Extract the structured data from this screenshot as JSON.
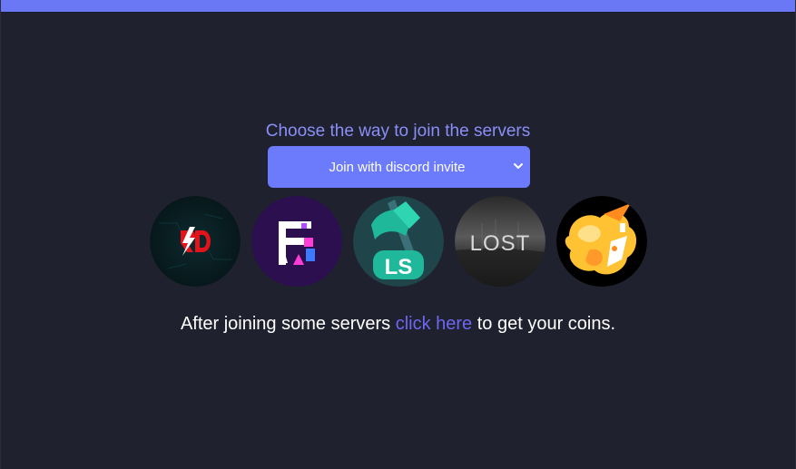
{
  "prompt": "Choose the way to join the servers",
  "join_method": {
    "selected": "Join with discord invite"
  },
  "servers": [
    {
      "icon": "rd-lightning-icon",
      "label": "RD"
    },
    {
      "icon": "purple-f-logo-icon"
    },
    {
      "icon": "ls-axe-logo-icon",
      "label": "LS"
    },
    {
      "icon": "lost-logo-icon",
      "label": "LOST"
    },
    {
      "icon": "orange-abstract-logo-icon"
    }
  ],
  "footer": {
    "before": "After joining some servers ",
    "link": "click here",
    "after": " to get your coins."
  },
  "colors": {
    "background": "#1f212e",
    "accent": "#6b78f5",
    "prompt": "#8a8ff7",
    "link": "#6e67f2"
  }
}
